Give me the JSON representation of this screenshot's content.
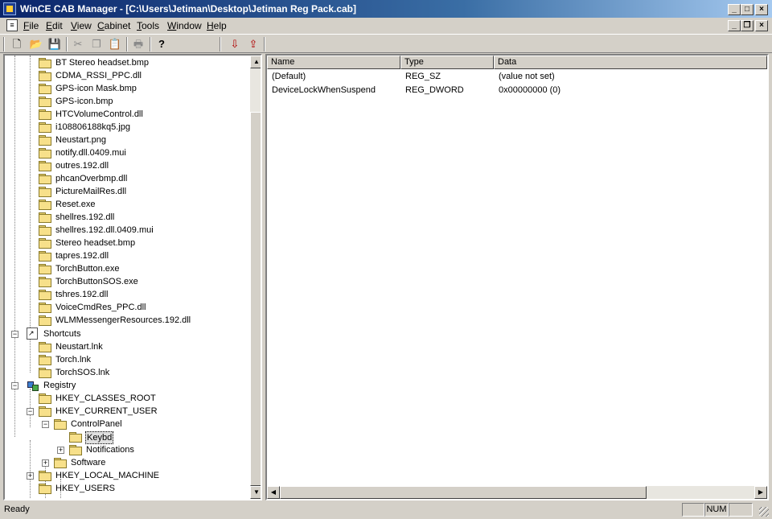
{
  "window": {
    "title": "WinCE CAB Manager - [C:\\Users\\Jetiman\\Desktop\\Jetiman Reg Pack.cab]",
    "caption_buttons": [
      "_",
      "□",
      "×"
    ]
  },
  "menu": {
    "items": [
      "File",
      "Edit",
      "View",
      "Cabinet",
      "Tools",
      "Window",
      "Help"
    ],
    "mdi_buttons": [
      "_",
      "❐",
      "×"
    ]
  },
  "toolbar": {
    "buttons": [
      {
        "name": "new-icon",
        "glyph": "🗋",
        "enabled": true
      },
      {
        "name": "open-folder-icon",
        "glyph": "📂",
        "enabled": true
      },
      {
        "name": "save-icon",
        "glyph": "💾",
        "enabled": true
      },
      {
        "name": "cut-icon",
        "glyph": "✂",
        "enabled": false
      },
      {
        "name": "copy-icon",
        "glyph": "❐",
        "enabled": false
      },
      {
        "name": "paste-icon",
        "glyph": "📋",
        "enabled": false
      },
      {
        "name": "print-icon",
        "glyph": "🖶",
        "enabled": false
      },
      {
        "name": "help-icon",
        "glyph": "?",
        "enabled": true
      },
      {
        "name": "extract-icon",
        "glyph": "⇩",
        "enabled": true
      },
      {
        "name": "insert-icon",
        "glyph": "⇪",
        "enabled": true
      }
    ]
  },
  "tree": {
    "files": [
      "BT Stereo headset.bmp",
      "CDMA_RSSI_PPC.dll",
      "GPS-icon Mask.bmp",
      "GPS-icon.bmp",
      "HTCVolumeControl.dll",
      "i108806188kq5.jpg",
      "Neustart.png",
      "notify.dll.0409.mui",
      "outres.192.dll",
      "phcanOverbmp.dll",
      "PictureMailRes.dll",
      "Reset.exe",
      "shellres.192.dll",
      "shellres.192.dll.0409.mui",
      "Stereo headset.bmp",
      "tapres.192.dll",
      "TorchButton.exe",
      "TorchButtonSOS.exe",
      "tshres.192.dll",
      "VoiceCmdRes_PPC.dll",
      "WLMMessengerResources.192.dll"
    ],
    "shortcuts_label": "Shortcuts",
    "shortcuts": [
      "Neustart.lnk",
      "Torch.lnk",
      "TorchSOS.lnk"
    ],
    "registry_label": "Registry",
    "hkcr": "HKEY_CLASSES_ROOT",
    "hkcu": "HKEY_CURRENT_USER",
    "controlpanel": "ControlPanel",
    "keybd": "Keybd",
    "notifications": "Notifications",
    "software": "Software",
    "hklm": "HKEY_LOCAL_MACHINE",
    "hku": "HKEY_USERS"
  },
  "list": {
    "columns": [
      "Name",
      "Type",
      "Data"
    ],
    "rows": [
      [
        "(Default)",
        "REG_SZ",
        "(value not set)"
      ],
      [
        "DeviceLockWhenSuspend",
        "REG_DWORD",
        "0x00000000 (0)"
      ]
    ]
  },
  "status": {
    "text": "Ready",
    "num": "NUM"
  }
}
